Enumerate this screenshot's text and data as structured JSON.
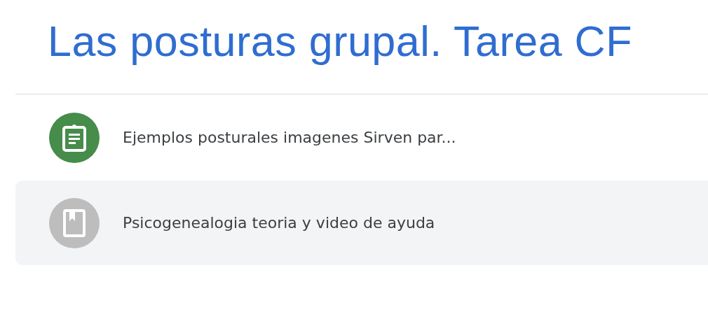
{
  "title": "Las posturas grupal. Tarea CF",
  "items": [
    {
      "kind": "assignment",
      "label": "Ejemplos posturales imagenes Sirven par...",
      "color": "#468c4a",
      "selected": false
    },
    {
      "kind": "material",
      "label": "Psicogenealogia teoria y video de ayuda",
      "color": "#bdbdbd",
      "selected": true
    }
  ]
}
